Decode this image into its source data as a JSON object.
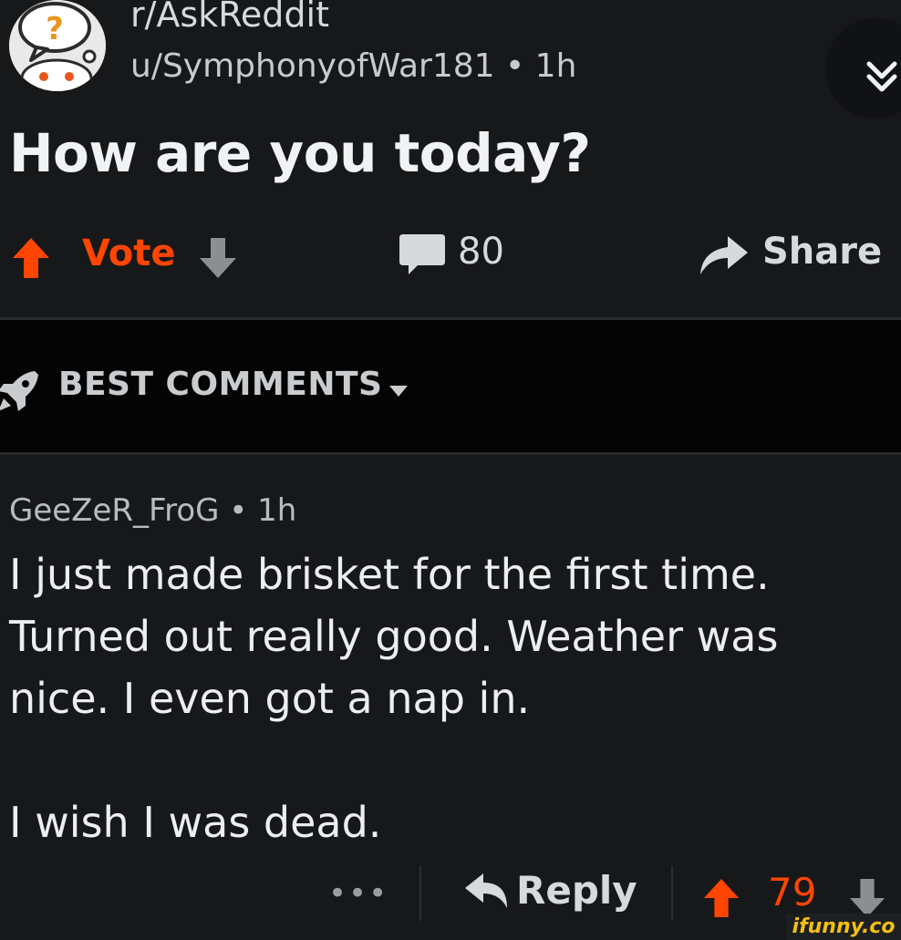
{
  "post": {
    "subreddit": "r/AskReddit",
    "meta": "u/SymphonyofWar181 • 1h",
    "title": "How are you today?",
    "vote_label": "Vote",
    "comment_count": "80",
    "share_label": "Share",
    "avatar_glyph": "?"
  },
  "sort": {
    "label": "BEST COMMENTS"
  },
  "comment": {
    "meta": "GeeZeR_FroG • 1h",
    "paragraphs": [
      "I just made brisket for the first time. Turned out really good. Weather was nice. I even got a nap in.",
      "I wish I was dead."
    ],
    "more_label": "•••",
    "reply_label": "Reply",
    "score": "79"
  },
  "watermark": "ifunny.co",
  "colors": {
    "background": "#17181a",
    "sort_bar": "#040404",
    "upvote": "#ff4500",
    "text": "#d7dadc",
    "watermark": "#f2c00f"
  },
  "icons": {
    "avatar": "askreddit-snoo-icon",
    "collapse": "double-chevron-down-icon",
    "upvote": "arrow-up-icon",
    "downvote": "arrow-down-icon",
    "comments": "speech-bubble-icon",
    "share": "share-arrow-icon",
    "sort": "rocket-icon",
    "caret": "caret-down-icon",
    "reply": "reply-arrow-icon"
  }
}
